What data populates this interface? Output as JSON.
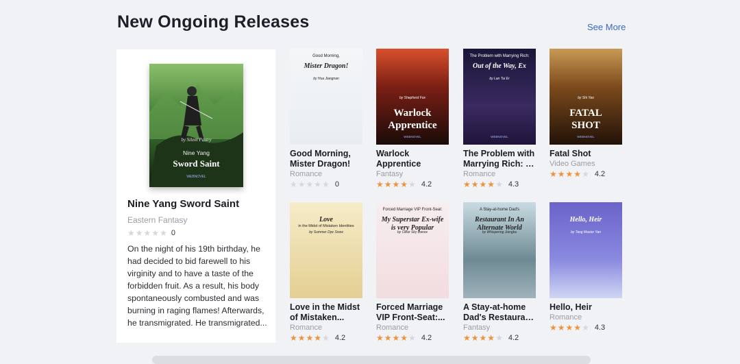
{
  "section": {
    "title": "New Ongoing Releases",
    "see_more": "See More"
  },
  "featured": {
    "title": "Nine Yang Sword Saint",
    "genre": "Eastern Fantasy",
    "rating": "0",
    "rating_value": 0,
    "description": "On the night of his 19th birthday, he had decided to bid farewell to his virginity and to have a taste of the forbidden fruit. As a result, his body spontaneously combusted and was burning in raging flames! Afterwards, he transmigrated. He transmigrated...",
    "cover": {
      "author": "by Silent Pastry",
      "line1": "Nine Yang",
      "line2": "Sword Saint",
      "publisher": "WEBNOVEL"
    }
  },
  "books": [
    {
      "title_line1": "Good Morning,",
      "title_line2": "Mister Dragon!",
      "genre": "Romance",
      "rating": "0",
      "rating_value": 0,
      "cover": {
        "top": "Good Morning,",
        "main": "Mister Dragon!",
        "author": "by Hua Jiangnan"
      }
    },
    {
      "title_line1": "Warlock",
      "title_line2": "Apprentice",
      "genre": "Fantasy",
      "rating": "4.2",
      "rating_value": 4.2,
      "cover": {
        "author": "by Shepherd Fox",
        "main1": "Warlock",
        "main2": "Apprentice",
        "publisher": "WEBNOVEL"
      }
    },
    {
      "title_line1": "The Problem with",
      "title_line2": "Marrying Rich: O...",
      "genre": "Romance",
      "rating": "4.3",
      "rating_value": 4.3,
      "cover": {
        "top": "The Problem with Marrying Rich:",
        "main": "Out of the Way, Ex",
        "author": "by Lan Tui Er",
        "publisher": "WEBNOVEL"
      }
    },
    {
      "title_line1": "Fatal Shot",
      "title_line2": "",
      "genre": "Video Games",
      "rating": "4.2",
      "rating_value": 4.2,
      "cover": {
        "author": "by Shi Yao",
        "main1": "FATAL",
        "main2": "SHOT",
        "publisher": "WEBNOVEL"
      }
    },
    {
      "title_line1": "Love in the Midst",
      "title_line2": "of Mistaken...",
      "genre": "Romance",
      "rating": "4.2",
      "rating_value": 4.2,
      "cover": {
        "main": "Love",
        "sub": "in the Midst of Mistaken Identities",
        "author": "by Summer Dye Snow"
      }
    },
    {
      "title_line1": "Forced Marriage",
      "title_line2": "VIP Front-Seat:...",
      "genre": "Romance",
      "rating": "4.2",
      "rating_value": 4.2,
      "cover": {
        "top": "Forced Marriage VIP Front-Seat:",
        "main": "My Superstar Ex-wife is very Popular",
        "author": "by Clear Sky Dance"
      }
    },
    {
      "title_line1": "A Stay-at-home",
      "title_line2": "Dad's Restaurant...",
      "genre": "Fantasy",
      "rating": "4.2",
      "rating_value": 4.2,
      "cover": {
        "top": "A Stay-at-home Dad's",
        "main": "Restaurant In An Alternate World",
        "author": "by Whispering Jiangbu"
      }
    },
    {
      "title_line1": "Hello, Heir",
      "title_line2": "",
      "genre": "Romance",
      "rating": "4.3",
      "rating_value": 4.3,
      "cover": {
        "main": "Hello, Heir",
        "author": "by Tang Master Yan"
      }
    }
  ],
  "colors": {
    "star_on": "#f0923a",
    "star_off": "#d6d6dc",
    "link": "#3b66c4",
    "background": "#f1f2f6"
  }
}
